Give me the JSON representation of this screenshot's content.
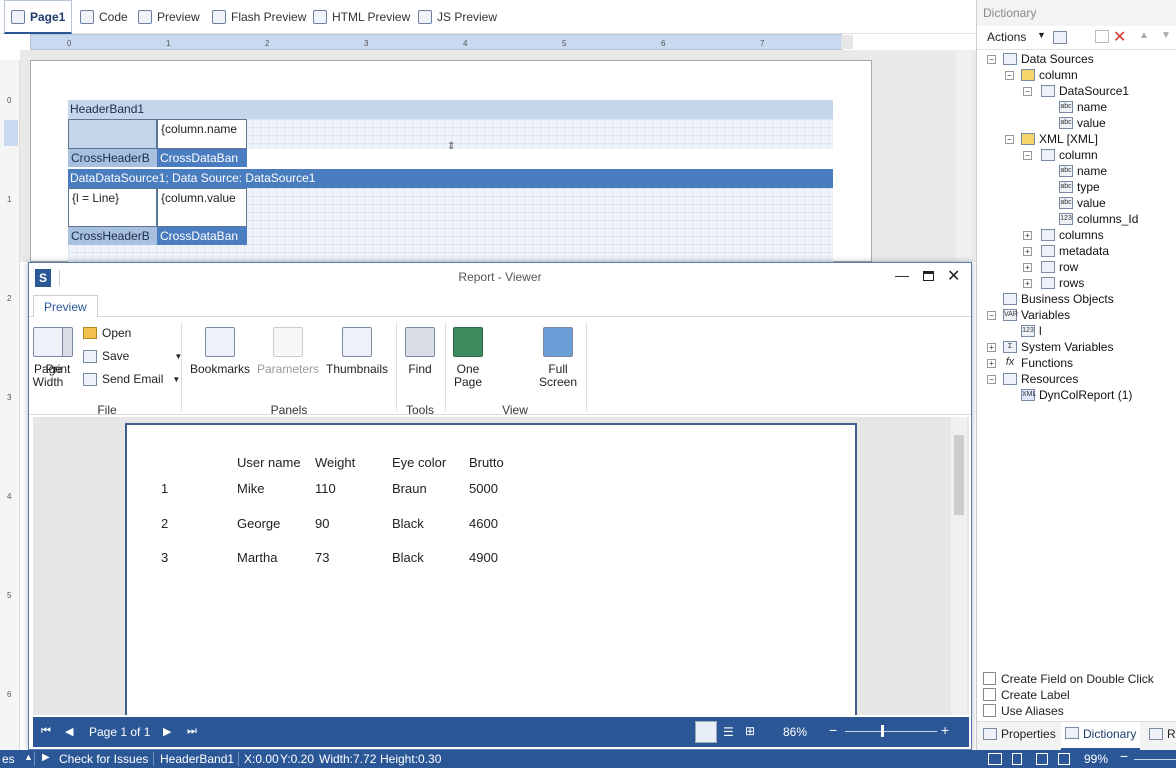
{
  "designer_tabs": [
    {
      "label": "Page1",
      "icon": "page-icon"
    },
    {
      "label": "Code",
      "icon": "code-icon"
    },
    {
      "label": "Preview",
      "icon": "preview-icon"
    },
    {
      "label": "Flash Preview",
      "icon": "flash-preview-icon"
    },
    {
      "label": "HTML Preview",
      "icon": "html-preview-icon"
    },
    {
      "label": "JS Preview",
      "icon": "js-preview-icon"
    }
  ],
  "ruler": {
    "h": [
      "0",
      "1",
      "2",
      "3",
      "4",
      "5",
      "6",
      "7"
    ],
    "v": [
      "0",
      "1",
      "2",
      "3",
      "4",
      "5",
      "6"
    ]
  },
  "design": {
    "header_band": "HeaderBand1",
    "column_name": "{column.name",
    "cross_header": "CrossHeaderB",
    "cross_data": "CrossDataBan",
    "data_band": "DataDataSource1; Data Source: DataSource1",
    "line": "{l = Line}",
    "column_value": "{column.value",
    "cross_header2": "CrossHeaderB",
    "cross_data2": "CrossDataBan"
  },
  "dictionary": {
    "title": "Dictionary",
    "actions_label": "Actions",
    "tree": {
      "data_sources": "Data Sources",
      "column": "column",
      "datasource1": "DataSource1",
      "ds_name": "name",
      "ds_value": "value",
      "xml": "XML [XML]",
      "xml_column": "column",
      "x_name": "name",
      "x_type": "type",
      "x_value": "value",
      "x_columns_id": "columns_Id",
      "columns": "columns",
      "metadata": "metadata",
      "row": "row",
      "rows": "rows",
      "business_objects": "Business Objects",
      "variables": "Variables",
      "var_l": "l",
      "system_variables": "System Variables",
      "functions": "Functions",
      "resources": "Resources",
      "dyncol": "DynColReport (1)"
    },
    "options": [
      "Create Field on Double Click",
      "Create Label",
      "Use Aliases"
    ],
    "bottom_tabs": {
      "properties": "Properties",
      "dictionary": "Dictionary",
      "r": "R"
    }
  },
  "viewer": {
    "title": "Report - Viewer",
    "tab": "Preview",
    "file": {
      "print": "Print",
      "open": "Open",
      "save": "Save",
      "send_email": "Send Email",
      "group": "File"
    },
    "panels": {
      "bookmarks": "Bookmarks",
      "parameters": "Parameters",
      "thumbnails": "Thumbnails",
      "group": "Panels"
    },
    "tools": {
      "find": "Find",
      "group": "Tools"
    },
    "view": {
      "one_page_1": "One",
      "one_page_2": "Page",
      "page_width_1": "Page",
      "page_width_2": "Width",
      "full_screen_1": "Full",
      "full_screen_2": "Screen",
      "group": "View"
    },
    "report": {
      "headers": [
        "User name",
        "Weight",
        "Eye color",
        "Brutto"
      ],
      "rows": [
        {
          "n": "1",
          "name": "Mike",
          "weight": "110",
          "eye": "Braun",
          "brutto": "5000"
        },
        {
          "n": "2",
          "name": "George",
          "weight": "90",
          "eye": "Black",
          "brutto": "4600"
        },
        {
          "n": "3",
          "name": "Martha",
          "weight": "73",
          "eye": "Black",
          "brutto": "4900"
        }
      ]
    },
    "status": {
      "page": "Page 1 of 1",
      "zoom": "86%"
    }
  },
  "statusbar": {
    "left": "es",
    "check": "Check for Issues",
    "component": "HeaderBand1",
    "x": "X:0.00",
    "y": "Y:0.20",
    "width": "Width:7.72",
    "height": "Height:0.30",
    "zoom": "99%"
  }
}
